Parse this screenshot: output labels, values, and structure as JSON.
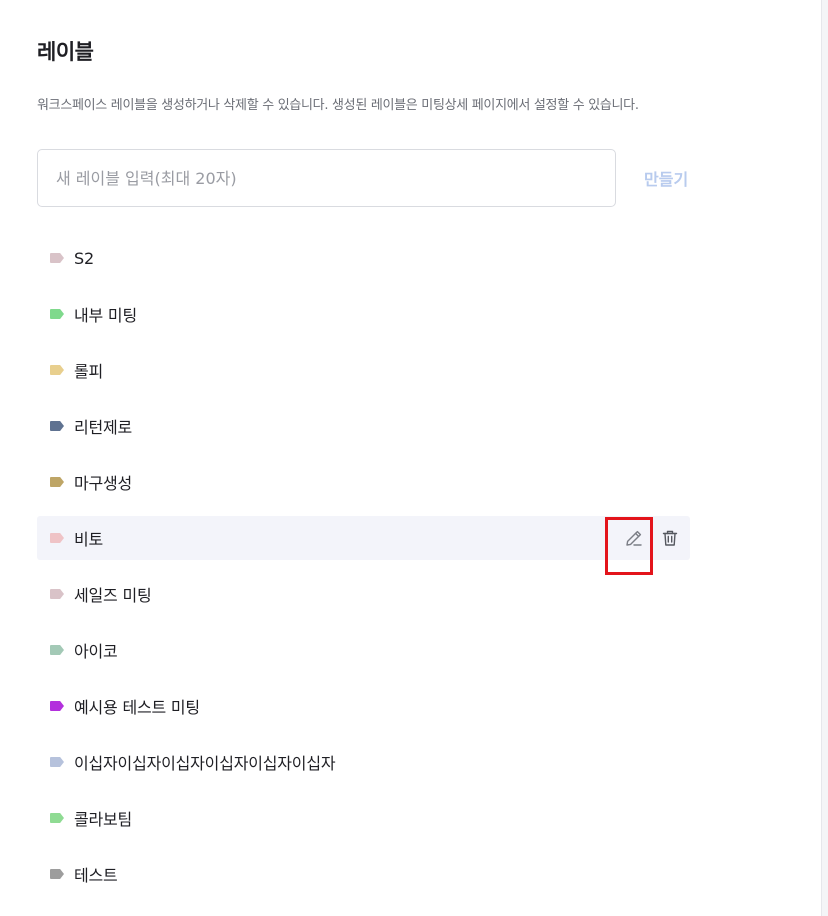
{
  "section": {
    "title": "레이블",
    "description": "워크스페이스 레이블을 생성하거나 삭제할 수 있습니다. 생성된 레이블은 미팅상세 페이지에서 설정할 수 있습니다."
  },
  "create": {
    "placeholder": "새 레이블 입력(최대 20자)",
    "value": "",
    "button_label": "만들기"
  },
  "labels": [
    {
      "name": "S2",
      "color": "#d9c3c8"
    },
    {
      "name": "내부 미팅",
      "color": "#7fd98c"
    },
    {
      "name": "롤피",
      "color": "#e8cf8e"
    },
    {
      "name": "리턴제로",
      "color": "#5f7291"
    },
    {
      "name": "마구생성",
      "color": "#bea566"
    },
    {
      "name": "비토",
      "color": "#efc3c6"
    },
    {
      "name": "세일즈 미팅",
      "color": "#d9c3c8"
    },
    {
      "name": "아이코",
      "color": "#a3c9b6"
    },
    {
      "name": "예시용 테스트 미팅",
      "color": "#b330dd"
    },
    {
      "name": "이십자이십자이십자이십자이십자이십자",
      "color": "#b6c2dc"
    },
    {
      "name": "콜라보팀",
      "color": "#8fdb93"
    },
    {
      "name": "테스트",
      "color": "#9d9d9d"
    }
  ],
  "hovered_row": 5,
  "row_actions": {
    "edit_icon": "pencil-icon",
    "delete_icon": "trash-icon"
  }
}
